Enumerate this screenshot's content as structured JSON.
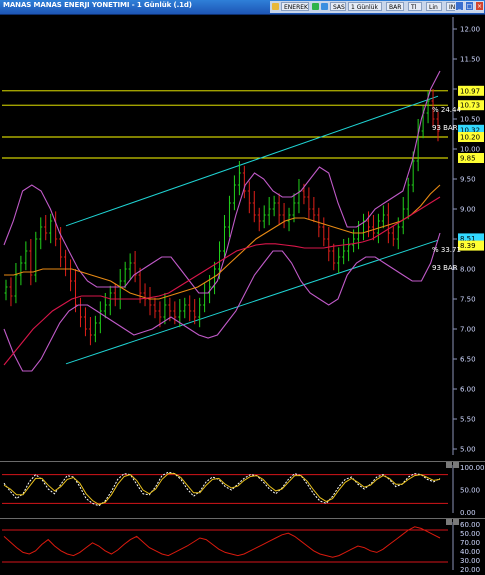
{
  "window": {
    "title": "MANAS MANAS ENERJI YONETIMI - 1 Günlük (.1d)",
    "toolbar": {
      "items": [
        "ENEREK",
        "SAS",
        "1 Günlük",
        "BAR",
        "Tl",
        "Lin",
        "IND"
      ]
    },
    "controls": [
      "_",
      "□",
      "×"
    ]
  },
  "colors": {
    "background": "#000000",
    "candle_up": "#22d21b",
    "candle_down": "#e0201a",
    "channel": "#1fd3d3",
    "bollinger": "#c05ac8",
    "ma_orange": "#e88a14",
    "ma_red": "#d9164a",
    "horizontal_level": "#ffff00",
    "tag_yellow": "#ffff33",
    "tag_cyan": "#33d9ff",
    "stoch_k": "#ffffff",
    "stoch_d": "#e8c01a",
    "rsi": "#d91a0e",
    "band_line": "#d4141a"
  },
  "chart_data": [
    {
      "type": "line",
      "name": "price-panel",
      "y_ticks": [
        "12.00",
        "11.50",
        "11.00",
        "10.50",
        "10.00",
        "9.50",
        "9.00",
        "8.50",
        "8.00",
        "7.50",
        "7.00",
        "6.50",
        "6.00",
        "5.50",
        "5.00"
      ],
      "ylim": [
        4.9,
        12.2
      ],
      "horizontal_levels": [
        10.97,
        10.73,
        10.2,
        9.85
      ],
      "value_tags": [
        {
          "label": "10.97",
          "value": 10.97,
          "color": "yellow"
        },
        {
          "label": "10.73",
          "value": 10.73,
          "color": "yellow"
        },
        {
          "label": "10.32",
          "value": 10.32,
          "color": "cyan"
        },
        {
          "label": "10.20",
          "value": 10.2,
          "color": "yellow"
        },
        {
          "label": "9.85",
          "value": 9.85,
          "color": "yellow"
        },
        {
          "label": "8.51",
          "value": 8.51,
          "color": "cyan"
        },
        {
          "label": "8.39",
          "value": 8.39,
          "color": "yellow"
        }
      ],
      "annotations": [
        "% 24.44",
        "93 BAR",
        "% 33.71",
        "93 BAR"
      ],
      "close_series": [
        7.7,
        7.55,
        7.9,
        8.1,
        8.3,
        7.9,
        8.5,
        8.7,
        8.6,
        8.8,
        8.5,
        8.2,
        8.0,
        7.8,
        7.4,
        7.2,
        7.0,
        6.9,
        7.1,
        7.3,
        7.4,
        7.6,
        7.5,
        7.8,
        8.0,
        8.1,
        7.9,
        7.6,
        7.5,
        7.4,
        7.3,
        7.2,
        7.4,
        7.3,
        7.2,
        7.3,
        7.4,
        7.3,
        7.2,
        7.4,
        7.6,
        7.7,
        8.0,
        8.3,
        8.7,
        9.1,
        9.4,
        9.6,
        9.3,
        9.1,
        8.9,
        8.8,
        8.9,
        9.0,
        9.1,
        8.9,
        8.8,
        8.9,
        9.1,
        9.3,
        9.2,
        9.0,
        8.9,
        8.7,
        8.5,
        8.3,
        8.1,
        8.2,
        8.3,
        8.4,
        8.5,
        8.6,
        8.8,
        8.7,
        8.6,
        8.8,
        8.9,
        8.6,
        8.5,
        8.7,
        9.0,
        9.4,
        9.8,
        10.3,
        10.6,
        10.8,
        10.5,
        10.3
      ],
      "ma_orange": [
        7.9,
        7.9,
        7.95,
        7.95,
        8.0,
        8.0,
        8.0,
        8.0,
        7.95,
        7.9,
        7.85,
        7.8,
        7.7,
        7.6,
        7.55,
        7.5,
        7.5,
        7.55,
        7.6,
        7.65,
        7.7,
        7.8,
        7.9,
        8.05,
        8.2,
        8.35,
        8.5,
        8.6,
        8.7,
        8.8,
        8.85,
        8.85,
        8.8,
        8.75,
        8.7,
        8.65,
        8.6,
        8.6,
        8.65,
        8.7,
        8.75,
        8.8,
        8.9,
        9.05,
        9.25,
        9.4
      ],
      "ma_red": [
        6.4,
        6.6,
        6.8,
        7.0,
        7.15,
        7.3,
        7.4,
        7.5,
        7.55,
        7.55,
        7.55,
        7.5,
        7.5,
        7.5,
        7.5,
        7.52,
        7.55,
        7.6,
        7.7,
        7.8,
        7.9,
        8.0,
        8.1,
        8.2,
        8.3,
        8.35,
        8.4,
        8.42,
        8.42,
        8.4,
        8.38,
        8.35,
        8.35,
        8.35,
        8.38,
        8.4,
        8.42,
        8.45,
        8.5,
        8.6,
        8.7,
        8.8,
        8.9,
        9.0,
        9.1,
        9.2
      ],
      "bb_upper": [
        8.4,
        8.8,
        9.3,
        9.4,
        9.3,
        9.0,
        8.6,
        8.3,
        8.0,
        7.8,
        7.7,
        7.7,
        7.7,
        7.7,
        7.9,
        8.0,
        8.1,
        8.2,
        8.2,
        8.0,
        7.8,
        7.6,
        7.6,
        7.8,
        8.3,
        8.9,
        9.4,
        9.6,
        9.5,
        9.3,
        9.2,
        9.2,
        9.3,
        9.5,
        9.7,
        9.6,
        9.1,
        8.7,
        8.7,
        8.8,
        9.0,
        9.1,
        9.2,
        9.3,
        9.8,
        10.5,
        11.0,
        11.3
      ],
      "bb_lower": [
        7.0,
        6.6,
        6.3,
        6.3,
        6.5,
        6.8,
        7.1,
        7.3,
        7.4,
        7.4,
        7.3,
        7.2,
        7.1,
        7.0,
        6.9,
        6.95,
        7.0,
        7.1,
        7.2,
        7.1,
        7.0,
        6.9,
        6.85,
        6.9,
        7.1,
        7.3,
        7.6,
        7.9,
        8.1,
        8.3,
        8.3,
        8.1,
        7.8,
        7.6,
        7.5,
        7.4,
        7.5,
        7.9,
        8.1,
        8.2,
        8.2,
        8.1,
        8.0,
        7.9,
        7.8,
        7.8,
        8.1,
        8.6
      ]
    },
    {
      "type": "line",
      "name": "stochastic-panel",
      "y_ticks": [
        "100.00",
        "50.00",
        "0.00"
      ],
      "ylim": [
        0,
        100
      ],
      "bands": [
        80,
        20
      ],
      "series": [
        {
          "values": [
            62,
            45,
            30,
            40,
            65,
            80,
            70,
            50,
            40,
            60,
            78,
            75,
            55,
            30,
            20,
            15,
            25,
            45,
            70,
            82,
            80,
            60,
            40,
            38,
            55,
            78,
            85,
            82,
            70,
            50,
            35,
            45,
            65,
            75,
            70,
            55,
            48,
            60,
            72,
            80,
            78,
            65,
            50,
            40,
            52,
            70,
            82,
            78,
            60,
            40,
            25,
            20,
            35,
            55,
            70,
            75,
            60,
            50,
            60,
            75,
            80,
            70,
            55,
            60,
            75,
            82,
            80,
            70,
            65,
            72
          ]
        },
        {
          "values": [
            58,
            50,
            38,
            38,
            55,
            72,
            72,
            58,
            46,
            55,
            70,
            74,
            62,
            40,
            26,
            18,
            22,
            38,
            60,
            76,
            80,
            68,
            48,
            40,
            50,
            70,
            82,
            82,
            74,
            58,
            42,
            42,
            58,
            70,
            72,
            60,
            52,
            56,
            68,
            76,
            78,
            70,
            56,
            46,
            50,
            64,
            78,
            78,
            66,
            48,
            32,
            24,
            30,
            48,
            64,
            72,
            64,
            54,
            58,
            70,
            78,
            72,
            60,
            60,
            70,
            78,
            80,
            74,
            68,
            70
          ]
        }
      ]
    },
    {
      "type": "line",
      "name": "rsi-panel",
      "y_ticks": [
        "60.00",
        "50.00",
        "70.00",
        "40.00",
        "30.00",
        "20.00"
      ],
      "ylim": [
        20,
        80
      ],
      "bands": [
        70,
        30
      ],
      "series": [
        {
          "values": [
            62,
            55,
            48,
            42,
            40,
            44,
            52,
            58,
            50,
            44,
            40,
            38,
            42,
            48,
            54,
            50,
            44,
            40,
            45,
            52,
            58,
            62,
            55,
            48,
            44,
            40,
            38,
            42,
            46,
            50,
            55,
            60,
            58,
            52,
            46,
            42,
            40,
            38,
            40,
            44,
            48,
            52,
            56,
            60,
            64,
            66,
            62,
            56,
            50,
            44,
            40,
            38,
            36,
            38,
            42,
            46,
            50,
            48,
            44,
            42,
            46,
            52,
            58,
            64,
            70,
            74,
            72,
            68,
            64,
            60
          ]
        }
      ]
    }
  ]
}
